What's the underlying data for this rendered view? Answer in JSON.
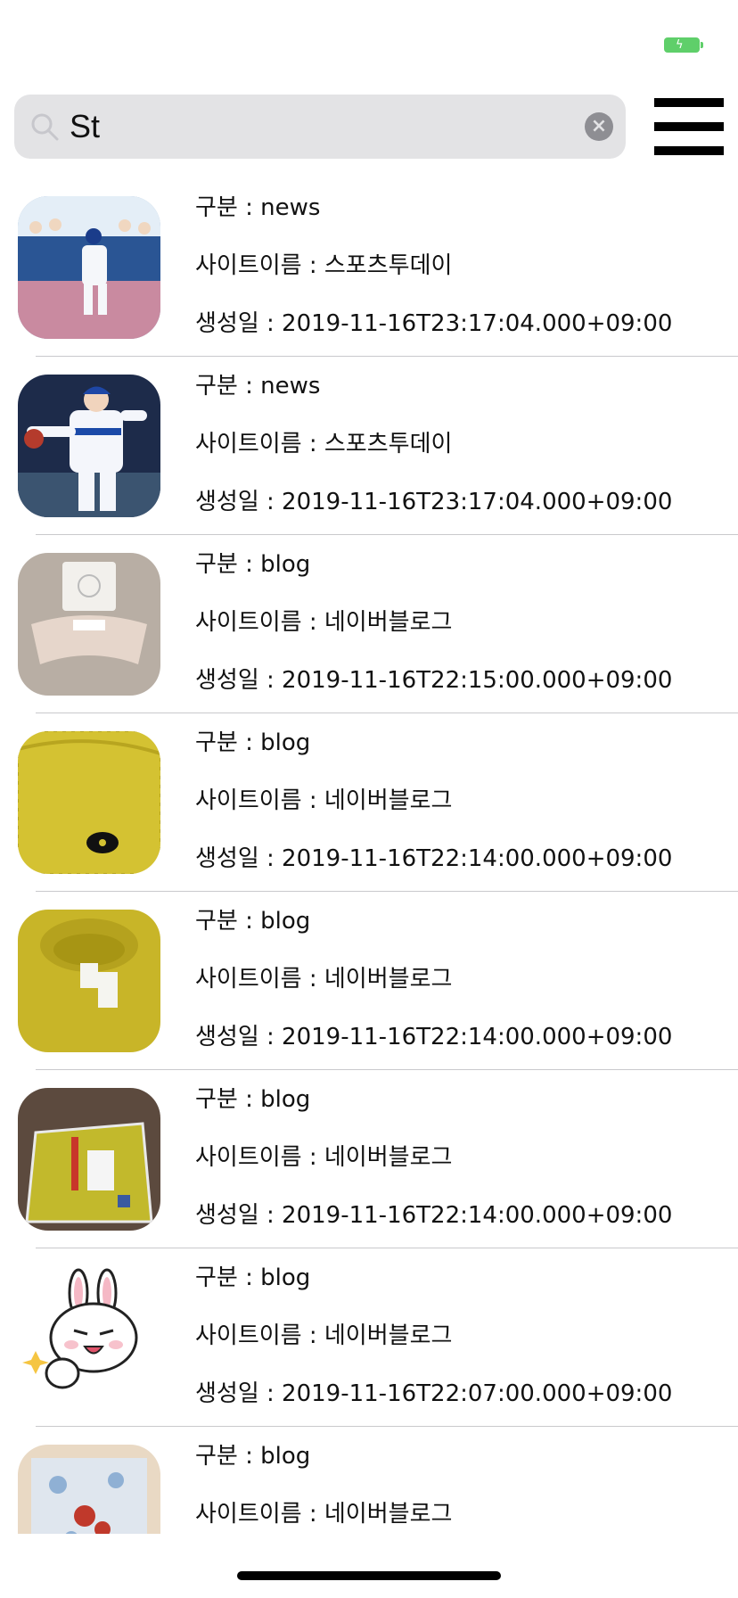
{
  "search": {
    "value": "St"
  },
  "list_items": [
    {
      "category": "구분 : news",
      "site": "사이트이름 : 스포츠투데이",
      "date": "생성일 : 2019-11-16T23:17:04.000+09:00"
    },
    {
      "category": "구분 : news",
      "site": "사이트이름 : 스포츠투데이",
      "date": "생성일 : 2019-11-16T23:17:04.000+09:00"
    },
    {
      "category": "구분 : blog",
      "site": "사이트이름 : 네이버블로그",
      "date": "생성일 : 2019-11-16T22:15:00.000+09:00"
    },
    {
      "category": "구분 : blog",
      "site": "사이트이름 : 네이버블로그",
      "date": "생성일 : 2019-11-16T22:14:00.000+09:00"
    },
    {
      "category": "구분 : blog",
      "site": "사이트이름 : 네이버블로그",
      "date": "생성일 : 2019-11-16T22:14:00.000+09:00"
    },
    {
      "category": "구분 : blog",
      "site": "사이트이름 : 네이버블로그",
      "date": "생성일 : 2019-11-16T22:14:00.000+09:00"
    },
    {
      "category": "구분 : blog",
      "site": "사이트이름 : 네이버블로그",
      "date": "생성일 : 2019-11-16T22:07:00.000+09:00"
    },
    {
      "category": "구분 : blog",
      "site": "사이트이름 : 네이버블로그",
      "date": ""
    }
  ],
  "icons": {
    "battery": "battery-charging-icon",
    "search": "magnifier-icon",
    "clear": "clear-x-icon",
    "menu": "hamburger-menu-icon"
  },
  "colors": {
    "battery": "#5fcf6a",
    "search_bg": "#e3e3e5",
    "separator": "#c9c9cc"
  }
}
